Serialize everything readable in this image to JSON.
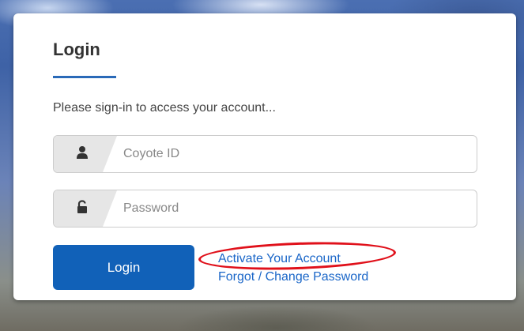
{
  "login_card": {
    "title": "Login",
    "subtitle": "Please sign-in to access your account...",
    "username_field": {
      "icon": "user-icon",
      "placeholder": "Coyote ID",
      "value": ""
    },
    "password_field": {
      "icon": "unlock-icon",
      "placeholder": "Password",
      "value": ""
    },
    "login_button_label": "Login",
    "links": {
      "activate_account": "Activate Your Account",
      "forgot_password": "Forgot / Change Password"
    }
  },
  "colors": {
    "primary_button": "#1161b8",
    "link": "#1a66c8",
    "title_underline": "#2a6ab8",
    "highlight_annotation": "#e0101a"
  }
}
